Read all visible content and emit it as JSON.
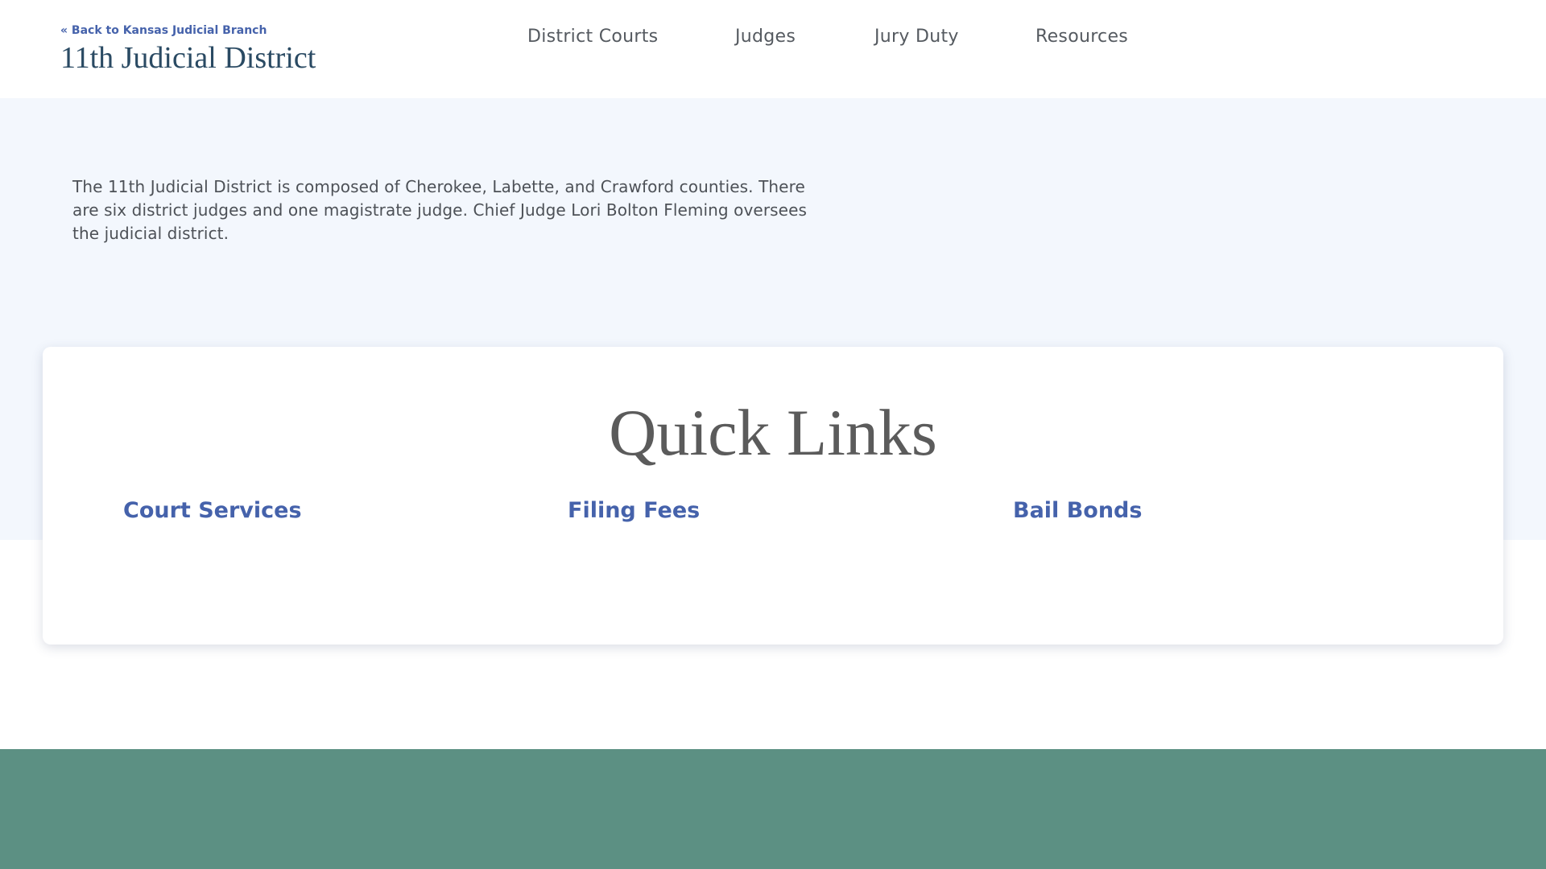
{
  "header": {
    "back_link": "« Back to Kansas Judicial Branch",
    "site_title": "11th Judicial District",
    "nav": [
      {
        "label": "District Courts"
      },
      {
        "label": "Judges"
      },
      {
        "label": "Jury Duty"
      },
      {
        "label": "Resources"
      }
    ]
  },
  "hero": {
    "intro_text": "The 11th Judicial District is composed of Cherokee, Labette, and Crawford counties. There are six district judges and one magistrate judge. Chief Judge Lori Bolton Fleming oversees the judicial district."
  },
  "quick_links": {
    "title": "Quick Links",
    "links": [
      {
        "label": "Court Services"
      },
      {
        "label": "Filing Fees"
      },
      {
        "label": "Bail Bonds"
      }
    ]
  },
  "colors": {
    "link_blue": "#4562ab",
    "title_navy": "#2a4a63",
    "hero_bg": "#f3f7fd",
    "footer_green": "#5c9083"
  }
}
